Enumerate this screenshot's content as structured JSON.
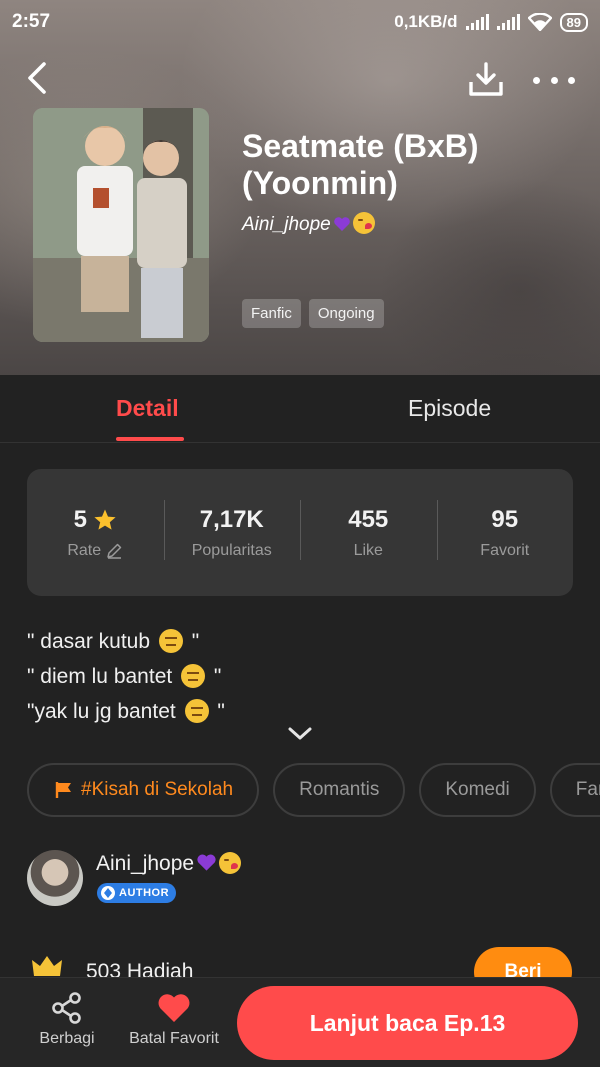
{
  "status_bar": {
    "time": "2:57",
    "network_speed": "0,1KB/d",
    "battery": "89"
  },
  "story": {
    "title": "Seatmate (BxB) (Yoonmin)",
    "author": "Aini_jhope",
    "tags": [
      "Fanfic",
      "Ongoing"
    ]
  },
  "tabs": [
    {
      "label": "Detail",
      "active": true
    },
    {
      "label": "Episode",
      "active": false
    }
  ],
  "stats": [
    {
      "value": "5",
      "label": "Rate"
    },
    {
      "value": "7,17K",
      "label": "Popularitas"
    },
    {
      "value": "455",
      "label": "Like"
    },
    {
      "value": "95",
      "label": "Favorit"
    }
  ],
  "synopsis": [
    "\" dasar kutub",
    "\" diem lu bantet",
    "\"yak lu jg bantet"
  ],
  "genres": [
    "#Kisah di Sekolah",
    "Romantis",
    "Komedi",
    "Fantasi"
  ],
  "author_card": {
    "name": "Aini_jhope",
    "badge": "AUTHOR"
  },
  "gifts": {
    "label": "503 Hadiah",
    "button": "Beri"
  },
  "bottom_bar": {
    "share_label": "Berbagi",
    "favorite_label": "Batal Favorit",
    "continue_label": "Lanjut baca Ep.13"
  },
  "colors": {
    "accent": "#ff4b4b",
    "orange": "#ff8c10",
    "background": "#222222",
    "badge_blue": "#2d7de4"
  }
}
